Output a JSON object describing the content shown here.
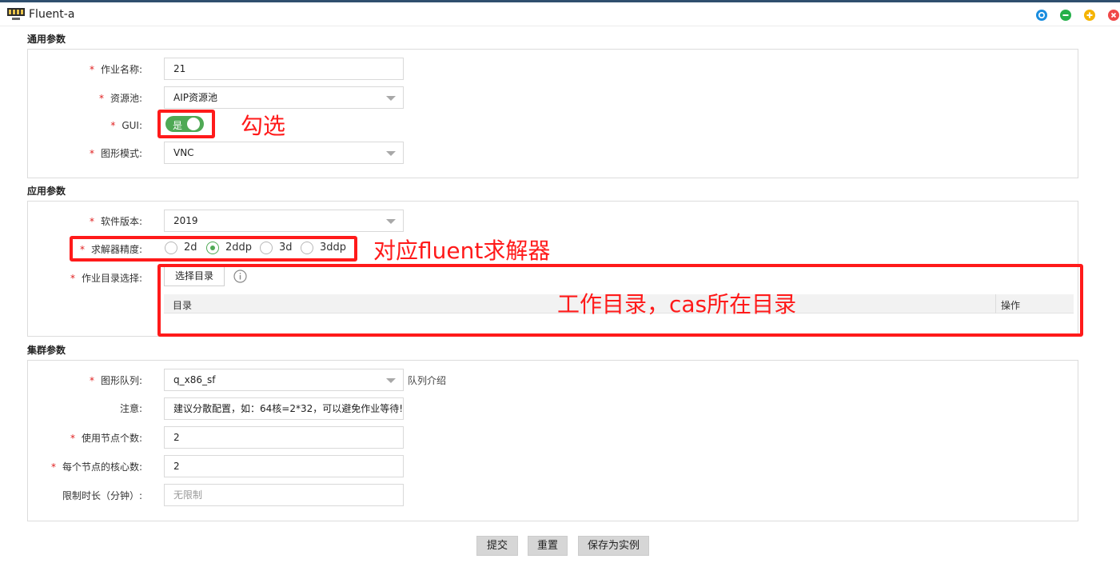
{
  "window": {
    "title": "Fluent-a",
    "controls": [
      {
        "name": "pin",
        "icon": "target-icon",
        "color": "#1a8ddf"
      },
      {
        "name": "minimize",
        "icon": "minus-icon",
        "color": "#25b04a"
      },
      {
        "name": "maximize",
        "icon": "plus-icon",
        "color": "#f5b400"
      },
      {
        "name": "close",
        "icon": "close-icon",
        "color": "#f04848"
      }
    ]
  },
  "sections": {
    "general": {
      "title": "通用参数",
      "job_name": {
        "label": "作业名称:",
        "value": "21"
      },
      "resource_pool": {
        "label": "资源池:",
        "value": "AIP资源池"
      },
      "gui": {
        "label": "GUI:",
        "toggle_text": "是",
        "checked": true
      },
      "graphics_mode": {
        "label": "图形模式:",
        "value": "VNC"
      }
    },
    "application": {
      "title": "应用参数",
      "software_version": {
        "label": "软件版本:",
        "value": "2019"
      },
      "solver_precision": {
        "label": "求解器精度:",
        "options": [
          "2d",
          "2ddp",
          "3d",
          "3ddp"
        ],
        "selected": "2ddp"
      },
      "work_dir": {
        "label": "作业目录选择:",
        "button_label": "选择目录",
        "columns": [
          "目录",
          "操作"
        ]
      }
    },
    "cluster": {
      "title": "集群参数",
      "graphics_queue": {
        "label": "图形队列:",
        "value": "q_x86_sf",
        "link": "队列介绍"
      },
      "note": {
        "label": "注意:",
        "value": "建议分散配置，如：64核=2*32，可以避免作业等待!"
      },
      "node_count": {
        "label": "使用节点个数:",
        "value": "2"
      },
      "cores_per_node": {
        "label": "每个节点的核心数:",
        "value": "2"
      },
      "time_limit": {
        "label": "限制时长（分钟）:",
        "placeholder": "无限制"
      }
    }
  },
  "actions": {
    "submit": "提交",
    "reset": "重置",
    "save_instance": "保存为实例"
  },
  "annotations": {
    "gui_note": "勾选",
    "solver_note": "对应fluent求解器",
    "dir_note": "工作目录，cas所在目录",
    "color": "#ff1a1a"
  }
}
